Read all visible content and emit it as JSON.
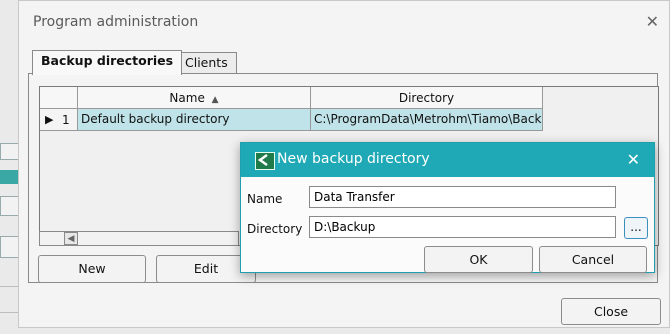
{
  "main_dialog": {
    "title": "Program administration",
    "tabs": [
      {
        "label": "Backup directories",
        "active": true
      },
      {
        "label": "Clients",
        "active": false
      }
    ],
    "grid": {
      "columns": [
        {
          "label": "Name",
          "sort_indicator": "▲"
        },
        {
          "label": "Directory"
        }
      ],
      "rows": [
        {
          "index": "1",
          "current_marker": "▶",
          "name": "Default backup directory",
          "directory": "C:\\ProgramData\\Metrohm\\Tiamo\\Backup",
          "selected": true
        }
      ]
    },
    "buttons": {
      "new": "New",
      "edit": "Edit",
      "close": "Close"
    }
  },
  "sub_dialog": {
    "title": "New backup directory",
    "fields": {
      "name": {
        "label": "Name",
        "value": "Data Transfer"
      },
      "directory": {
        "label": "Directory",
        "value": "D:\\Backup"
      }
    },
    "browse_label": "...",
    "buttons": {
      "ok": "OK",
      "cancel": "Cancel"
    }
  },
  "colors": {
    "accent": "#1fa9b6",
    "selection": "#bfe3e8"
  }
}
